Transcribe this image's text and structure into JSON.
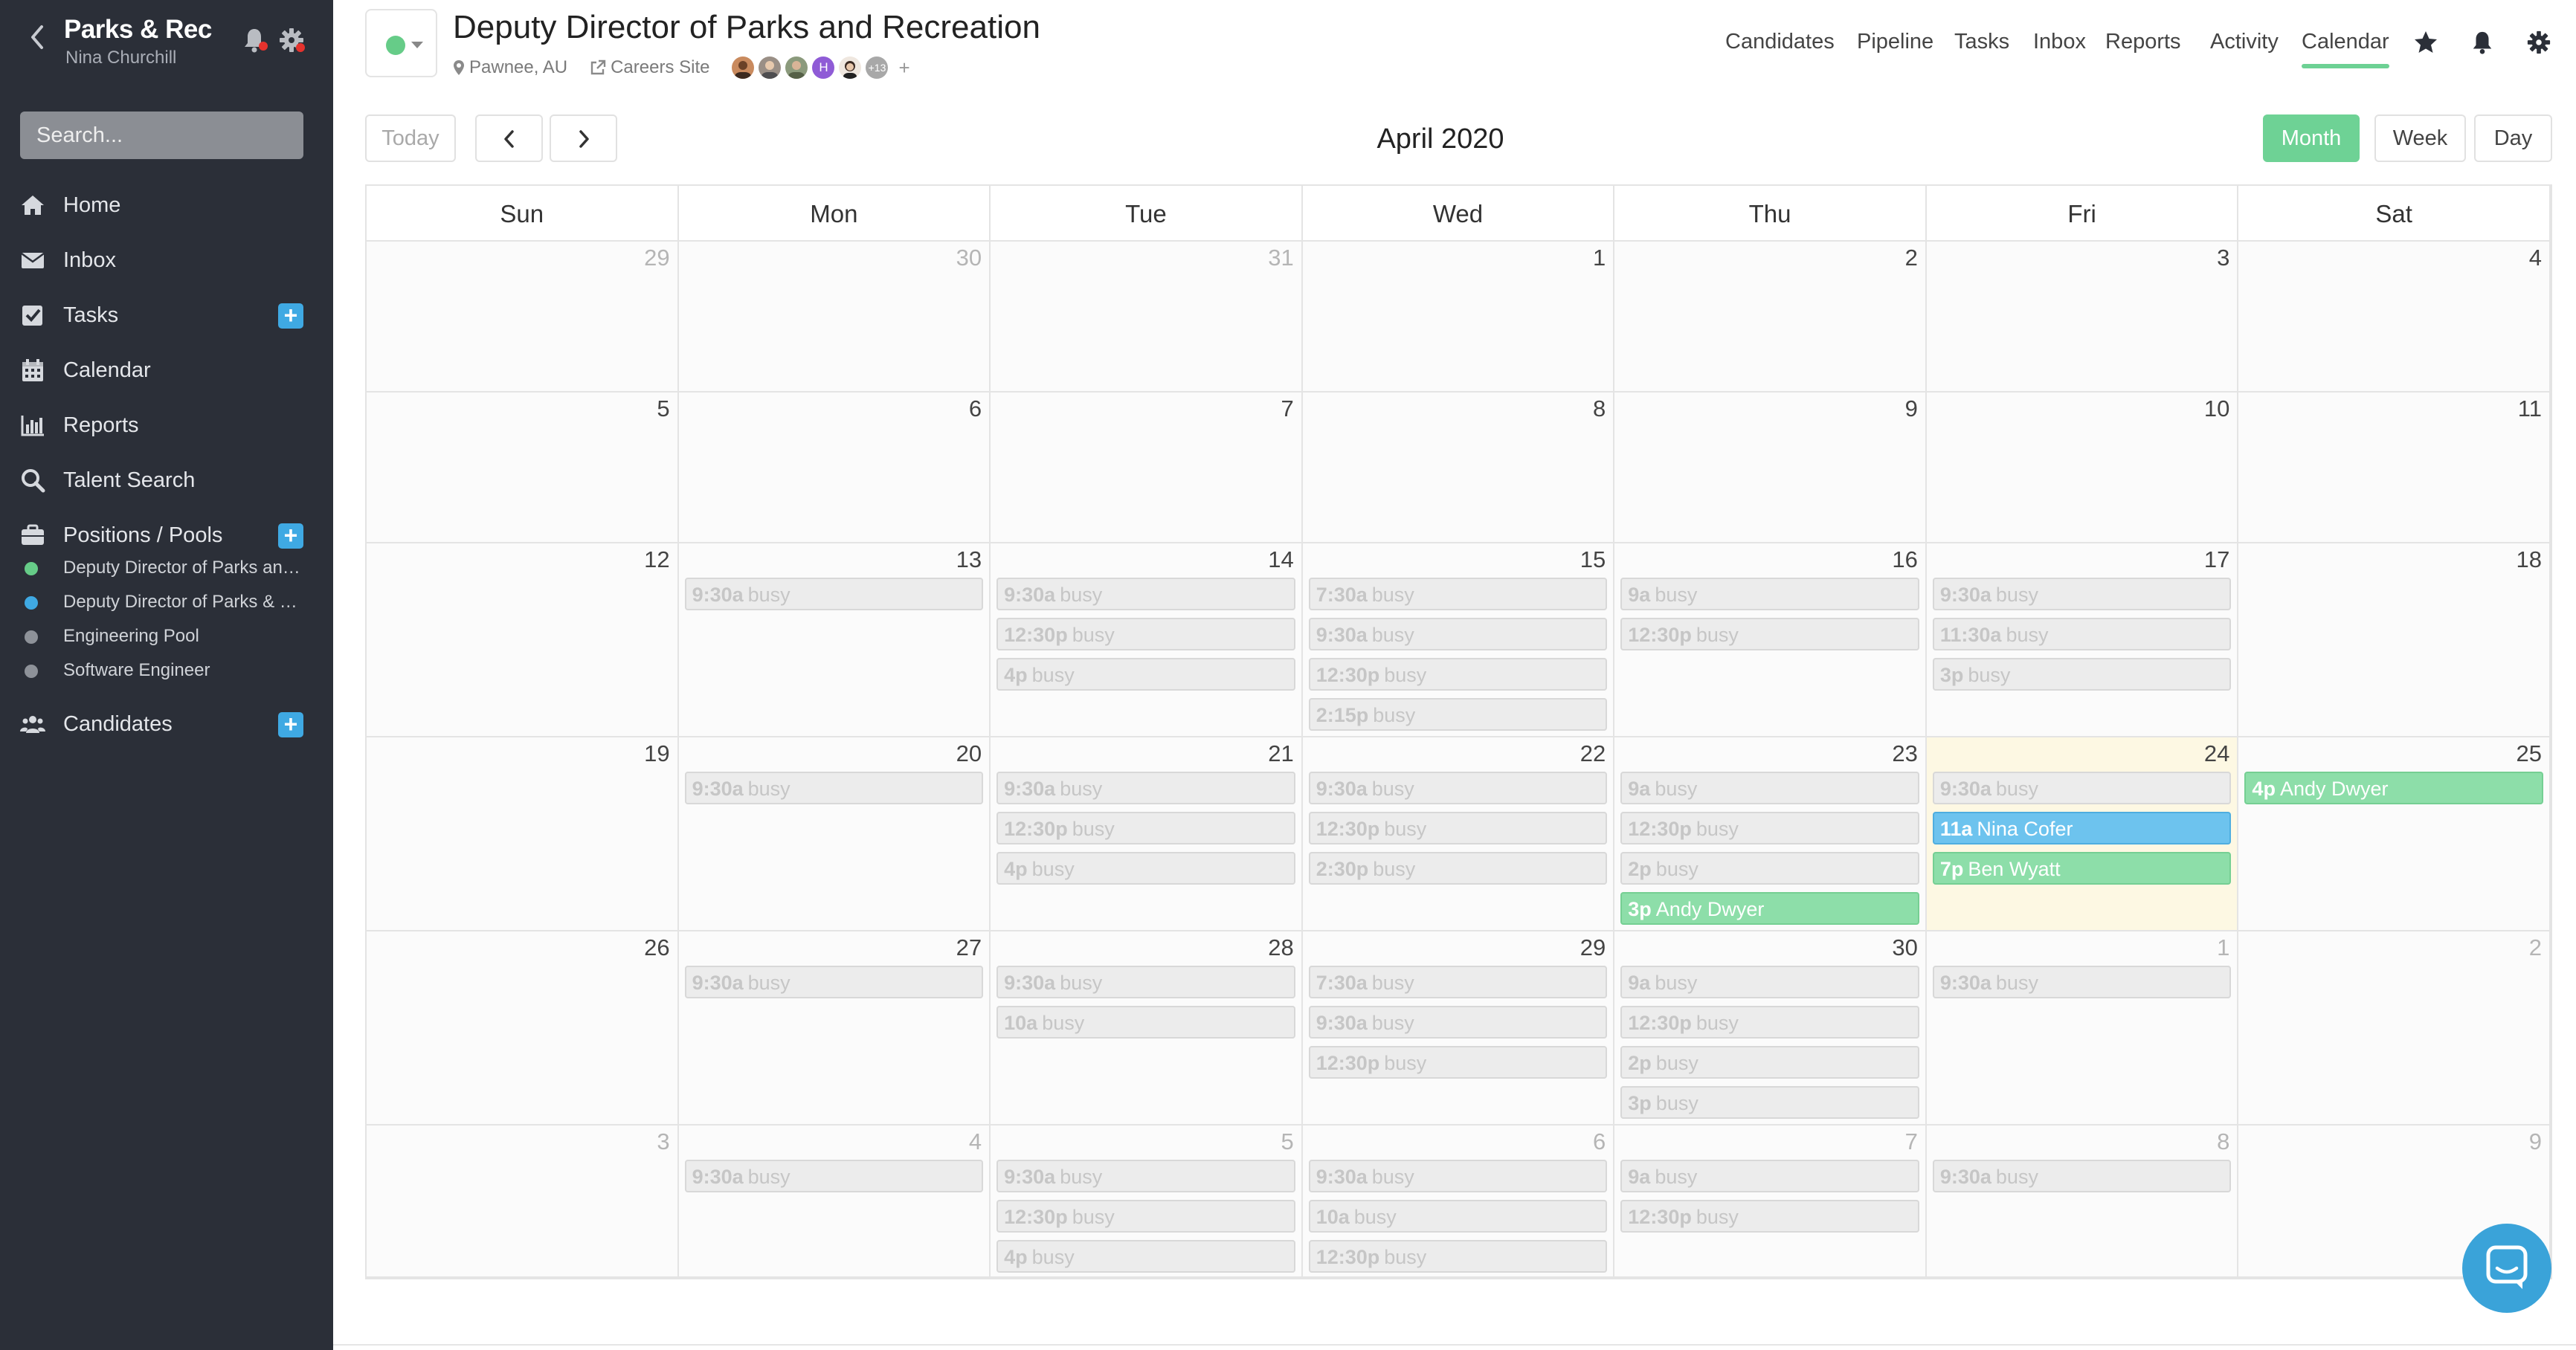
{
  "sidebar": {
    "org_name": "Parks & Rec",
    "user_name": "Nina Churchill",
    "search_placeholder": "Search...",
    "nav": [
      {
        "label": "Home",
        "icon": "home-icon"
      },
      {
        "label": "Inbox",
        "icon": "envelope-icon"
      },
      {
        "label": "Tasks",
        "icon": "checkbox-icon",
        "plus": true
      },
      {
        "label": "Calendar",
        "icon": "calendar-icon"
      },
      {
        "label": "Reports",
        "icon": "bar-chart-icon"
      },
      {
        "label": "Talent Search",
        "icon": "search-icon"
      },
      {
        "label": "Positions / Pools",
        "icon": "briefcase-icon",
        "plus": true
      },
      {
        "label": "Candidates",
        "icon": "users-icon",
        "plus": true
      }
    ],
    "positions": [
      {
        "label": "Deputy Director of Parks and Recreation",
        "color": "#66cc88"
      },
      {
        "label": "Deputy Director of Parks & Rec",
        "color": "#3fa9e3"
      },
      {
        "label": "Engineering Pool",
        "color": "#8e9299"
      },
      {
        "label": "Software Engineer",
        "color": "#8e9299"
      }
    ]
  },
  "header": {
    "title": "Deputy Director of Parks and Recreation",
    "location": "Pawnee, AU",
    "careers_link": "Careers Site",
    "avatar_letter": "H",
    "avatar_more": "+13",
    "avatar_add": "+",
    "status_color": "#66cc88"
  },
  "top_nav": [
    "Candidates",
    "Pipeline",
    "Tasks",
    "Inbox",
    "Reports",
    "Activity",
    "Calendar"
  ],
  "top_nav_active": "Calendar",
  "toolbar": {
    "today_label": "Today",
    "month_title": "April 2020",
    "views": [
      "Month",
      "Week",
      "Day"
    ],
    "active_view": "Month"
  },
  "calendar": {
    "weekdays": [
      "Sun",
      "Mon",
      "Tue",
      "Wed",
      "Thu",
      "Fri",
      "Sat"
    ],
    "today": "24",
    "weeks": [
      [
        {
          "day": "29",
          "other": true,
          "events": []
        },
        {
          "day": "30",
          "other": true,
          "events": []
        },
        {
          "day": "31",
          "other": true,
          "events": []
        },
        {
          "day": "1",
          "events": []
        },
        {
          "day": "2",
          "events": []
        },
        {
          "day": "3",
          "events": []
        },
        {
          "day": "4",
          "events": []
        }
      ],
      [
        {
          "day": "5",
          "events": []
        },
        {
          "day": "6",
          "events": []
        },
        {
          "day": "7",
          "events": []
        },
        {
          "day": "8",
          "events": []
        },
        {
          "day": "9",
          "events": []
        },
        {
          "day": "10",
          "events": []
        },
        {
          "day": "11",
          "events": []
        }
      ],
      [
        {
          "day": "12",
          "events": []
        },
        {
          "day": "13",
          "events": [
            {
              "time": "9:30a",
              "text": "busy",
              "kind": "busy"
            }
          ]
        },
        {
          "day": "14",
          "events": [
            {
              "time": "9:30a",
              "text": "busy",
              "kind": "busy"
            },
            {
              "time": "12:30p",
              "text": "busy",
              "kind": "busy"
            },
            {
              "time": "4p",
              "text": "busy",
              "kind": "busy"
            }
          ]
        },
        {
          "day": "15",
          "events": [
            {
              "time": "7:30a",
              "text": "busy",
              "kind": "busy"
            },
            {
              "time": "9:30a",
              "text": "busy",
              "kind": "busy"
            },
            {
              "time": "12:30p",
              "text": "busy",
              "kind": "busy"
            },
            {
              "time": "2:15p",
              "text": "busy",
              "kind": "busy"
            }
          ]
        },
        {
          "day": "16",
          "events": [
            {
              "time": "9a",
              "text": "busy",
              "kind": "busy"
            },
            {
              "time": "12:30p",
              "text": "busy",
              "kind": "busy"
            }
          ]
        },
        {
          "day": "17",
          "events": [
            {
              "time": "9:30a",
              "text": "busy",
              "kind": "busy"
            },
            {
              "time": "11:30a",
              "text": "busy",
              "kind": "busy"
            },
            {
              "time": "3p",
              "text": "busy",
              "kind": "busy"
            }
          ]
        },
        {
          "day": "18",
          "events": []
        }
      ],
      [
        {
          "day": "19",
          "events": []
        },
        {
          "day": "20",
          "events": [
            {
              "time": "9:30a",
              "text": "busy",
              "kind": "busy"
            }
          ]
        },
        {
          "day": "21",
          "events": [
            {
              "time": "9:30a",
              "text": "busy",
              "kind": "busy"
            },
            {
              "time": "12:30p",
              "text": "busy",
              "kind": "busy"
            },
            {
              "time": "4p",
              "text": "busy",
              "kind": "busy"
            }
          ]
        },
        {
          "day": "22",
          "events": [
            {
              "time": "9:30a",
              "text": "busy",
              "kind": "busy"
            },
            {
              "time": "12:30p",
              "text": "busy",
              "kind": "busy"
            },
            {
              "time": "2:30p",
              "text": "busy",
              "kind": "busy"
            }
          ]
        },
        {
          "day": "23",
          "events": [
            {
              "time": "9a",
              "text": "busy",
              "kind": "busy"
            },
            {
              "time": "12:30p",
              "text": "busy",
              "kind": "busy"
            },
            {
              "time": "2p",
              "text": "busy",
              "kind": "busy"
            },
            {
              "time": "3p",
              "text": "Andy Dwyer",
              "kind": "green"
            }
          ]
        },
        {
          "day": "24",
          "events": [
            {
              "time": "9:30a",
              "text": "busy",
              "kind": "busy"
            },
            {
              "time": "11a",
              "text": "Nina Cofer",
              "kind": "blue"
            },
            {
              "time": "7p",
              "text": "Ben Wyatt",
              "kind": "green"
            }
          ]
        },
        {
          "day": "25",
          "events": [
            {
              "time": "4p",
              "text": "Andy Dwyer",
              "kind": "green"
            }
          ]
        }
      ],
      [
        {
          "day": "26",
          "events": []
        },
        {
          "day": "27",
          "events": [
            {
              "time": "9:30a",
              "text": "busy",
              "kind": "busy"
            }
          ]
        },
        {
          "day": "28",
          "events": [
            {
              "time": "9:30a",
              "text": "busy",
              "kind": "busy"
            },
            {
              "time": "10a",
              "text": "busy",
              "kind": "busy"
            }
          ]
        },
        {
          "day": "29",
          "events": [
            {
              "time": "7:30a",
              "text": "busy",
              "kind": "busy"
            },
            {
              "time": "9:30a",
              "text": "busy",
              "kind": "busy"
            },
            {
              "time": "12:30p",
              "text": "busy",
              "kind": "busy"
            }
          ]
        },
        {
          "day": "30",
          "events": [
            {
              "time": "9a",
              "text": "busy",
              "kind": "busy"
            },
            {
              "time": "12:30p",
              "text": "busy",
              "kind": "busy"
            },
            {
              "time": "2p",
              "text": "busy",
              "kind": "busy"
            },
            {
              "time": "3p",
              "text": "busy",
              "kind": "busy"
            }
          ]
        },
        {
          "day": "1",
          "other": true,
          "events": [
            {
              "time": "9:30a",
              "text": "busy",
              "kind": "busy"
            }
          ]
        },
        {
          "day": "2",
          "other": true,
          "events": []
        }
      ],
      [
        {
          "day": "3",
          "other": true,
          "events": []
        },
        {
          "day": "4",
          "other": true,
          "events": [
            {
              "time": "9:30a",
              "text": "busy",
              "kind": "busy"
            }
          ]
        },
        {
          "day": "5",
          "other": true,
          "events": [
            {
              "time": "9:30a",
              "text": "busy",
              "kind": "busy"
            },
            {
              "time": "12:30p",
              "text": "busy",
              "kind": "busy"
            },
            {
              "time": "4p",
              "text": "busy",
              "kind": "busy"
            }
          ]
        },
        {
          "day": "6",
          "other": true,
          "events": [
            {
              "time": "9:30a",
              "text": "busy",
              "kind": "busy"
            },
            {
              "time": "10a",
              "text": "busy",
              "kind": "busy"
            },
            {
              "time": "12:30p",
              "text": "busy",
              "kind": "busy"
            }
          ]
        },
        {
          "day": "7",
          "other": true,
          "events": [
            {
              "time": "9a",
              "text": "busy",
              "kind": "busy"
            },
            {
              "time": "12:30p",
              "text": "busy",
              "kind": "busy"
            }
          ]
        },
        {
          "day": "8",
          "other": true,
          "events": [
            {
              "time": "9:30a",
              "text": "busy",
              "kind": "busy"
            }
          ]
        },
        {
          "day": "9",
          "other": true,
          "events": []
        }
      ]
    ]
  },
  "colors": {
    "sidebar_bg": "#2b2f38",
    "accent_green": "#6ed295",
    "accent_blue": "#3fa9e3",
    "today_bg": "#fdf8e3"
  }
}
